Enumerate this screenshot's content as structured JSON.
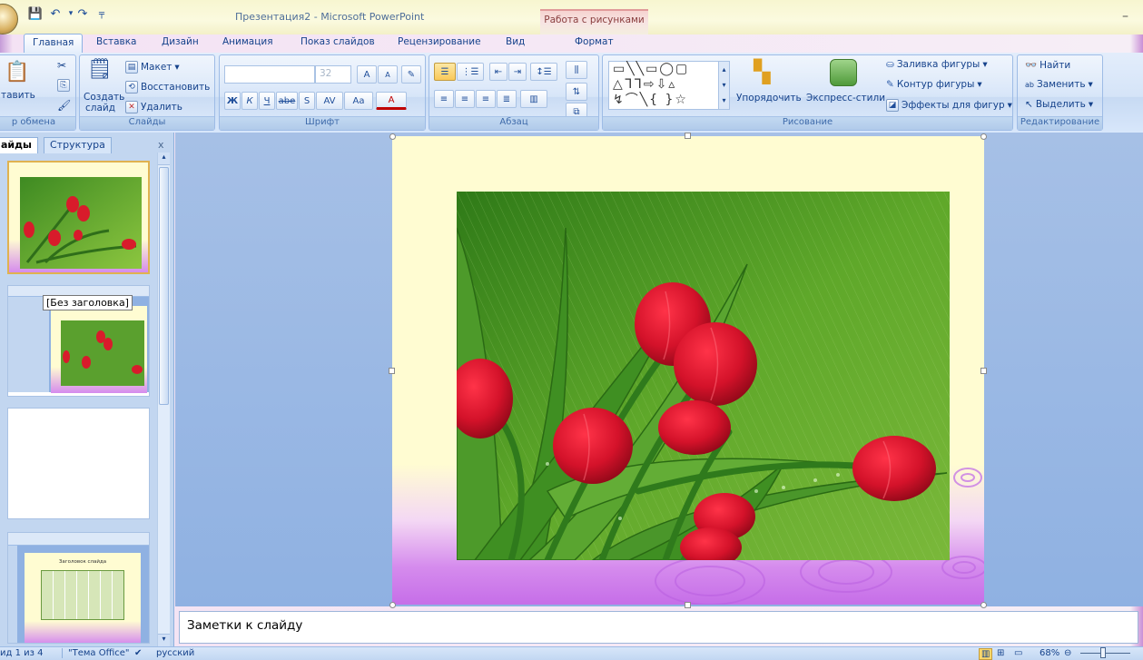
{
  "window": {
    "title": "Презентация2 - Microsoft PowerPoint",
    "context_tab_header": "Работа с рисунками",
    "minimize": "–"
  },
  "tabs": [
    "Главная",
    "Вставка",
    "Дизайн",
    "Анимация",
    "Показ слайдов",
    "Рецензирование",
    "Вид",
    "Формат"
  ],
  "ribbon": {
    "clipboard": {
      "paste": "тавить",
      "label": "р обмена"
    },
    "slides": {
      "layout": "Макет",
      "reset": "Восстановить",
      "new_slide_1": "Создать",
      "new_slide_2": "слайд",
      "delete": "Удалить",
      "label": "Слайды"
    },
    "font": {
      "size": "32",
      "bold": "Ж",
      "italic": "К",
      "underline": "Ч",
      "strike": "abe",
      "shadow": "S",
      "spacing": "AV",
      "case": "Aa",
      "color": "A",
      "grow": "A",
      "shrink": "A",
      "label": "Шрифт"
    },
    "paragraph": {
      "label": "Абзац"
    },
    "drawing": {
      "arrange": "Упорядочить",
      "quick_styles": "Экспресс-стили",
      "fill": "Заливка фигуры",
      "outline": "Контур фигуры",
      "effects": "Эффекты для фигур",
      "label": "Рисование"
    },
    "editing": {
      "find": "Найти",
      "replace": "Заменить",
      "select": "Выделить",
      "label": "Редактирование"
    }
  },
  "pane": {
    "tab_slides": "айды",
    "tab_outline": "Структура",
    "close": "x",
    "tooltip": "[Без заголовка]",
    "thumb4_title": "Заголовок слайда"
  },
  "notes": {
    "placeholder": "Заметки к слайду"
  },
  "status": {
    "slide": "ид 1 из 4",
    "theme": "\"Тема Office\"",
    "lang": "русский",
    "zoom": "68%"
  },
  "colors": {
    "ribbon": "#d5e4f8",
    "pane": "#c2d6f0",
    "editor": "#9ab8e4",
    "accent": "#15428b"
  }
}
